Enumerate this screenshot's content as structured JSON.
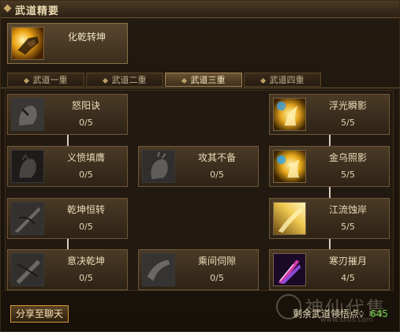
{
  "panel": {
    "title": "武道精要"
  },
  "top_skill": {
    "name": "化乾转坤",
    "icon": "golden-hand-icon"
  },
  "tabs": [
    {
      "label": "武道一重",
      "active": false
    },
    {
      "label": "武道二重",
      "active": false
    },
    {
      "label": "武道三重",
      "active": true
    },
    {
      "label": "武道四重",
      "active": false
    }
  ],
  "skills": {
    "nuyang": {
      "name": "怒阳诀",
      "level": "0/5",
      "icon": "fist-icon"
    },
    "yifen": {
      "name": "义愤填膺",
      "level": "0/5",
      "icon": "red-fist-icon"
    },
    "gongqi": {
      "name": "攻其不备",
      "level": "0/5",
      "icon": "fist-icon"
    },
    "qiankun": {
      "name": "乾坤恒转",
      "level": "0/5",
      "icon": "blade-icon"
    },
    "yijue": {
      "name": "意决乾坤",
      "level": "0/5",
      "icon": "blade-icon"
    },
    "chengjian": {
      "name": "乘间伺隙",
      "level": "0/5",
      "icon": "hand-icon"
    },
    "fuguang": {
      "name": "浮光瞬影",
      "level": "5/5",
      "icon": "golden-spirit-icon"
    },
    "jinwu": {
      "name": "金乌照影",
      "level": "5/5",
      "icon": "golden-spirit-icon"
    },
    "jiangliu": {
      "name": "江流蚀岸",
      "level": "5/5",
      "icon": "golden-blade-icon"
    },
    "hanren": {
      "name": "寒刃摧月",
      "level": "4/5",
      "icon": "crystal-blade-icon"
    }
  },
  "footer": {
    "share_label": "分享至聊天",
    "points_label": "剩余武道领悟点：",
    "points_value": "645"
  },
  "watermark": {
    "text": "神仙代售",
    "url": "www.sxds.com"
  },
  "colors": {
    "points_value": "#6fd84b",
    "share_border": "#d59a3a"
  }
}
